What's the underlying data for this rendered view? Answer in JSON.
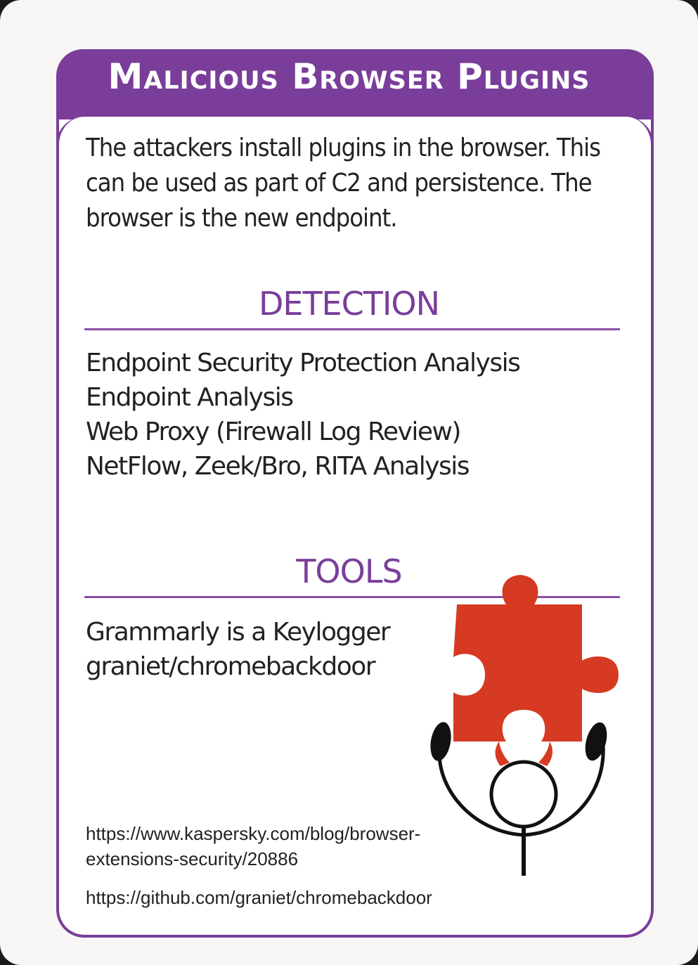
{
  "card": {
    "title": "Malicious Browser Plugins",
    "description": "The attackers install plugins in the browser. This can be used as part of C2 and persistence. The browser is the new endpoint.",
    "detection": {
      "heading": "DETECTION",
      "items": [
        "Endpoint Security Protection Analysis",
        "Endpoint Analysis",
        "Web Proxy (Firewall Log Review)",
        "NetFlow, Zeek/Bro, RITA Analysis"
      ]
    },
    "tools": {
      "heading": "TOOLS",
      "items": [
        "Grammarly is a Keylogger",
        "graniet/chromebackdoor"
      ]
    },
    "references": [
      "https://www.kaspersky.com/blog/browser-extensions-security/20886",
      "https://github.com/graniet/chromebackdoor"
    ],
    "illustration": "puzzle-piece-devil-icon"
  },
  "colors": {
    "accent": "#7a3e9a",
    "puzzle": "#d63a22",
    "text": "#222222"
  }
}
